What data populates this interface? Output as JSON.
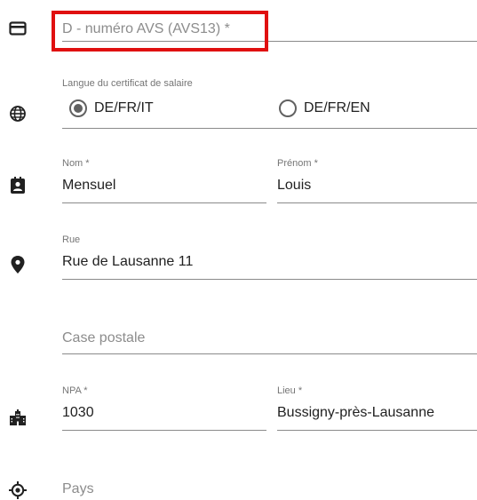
{
  "avs": {
    "placeholder": "D - numéro AVS (AVS13) *",
    "icon": "card-icon"
  },
  "language": {
    "label": "Langue du certificat de salaire",
    "icon": "globe-icon",
    "options": [
      {
        "label": "DE/FR/IT",
        "selected": true
      },
      {
        "label": "DE/FR/EN",
        "selected": false
      }
    ]
  },
  "person": {
    "icon": "contact-card-icon",
    "last_name_label": "Nom *",
    "last_name_value": "Mensuel",
    "first_name_label": "Prénom *",
    "first_name_value": "Louis"
  },
  "street": {
    "icon": "location-pin-icon",
    "label": "Rue",
    "value": "Rue de Lausanne 11"
  },
  "po_box": {
    "placeholder": "Case postale"
  },
  "city": {
    "icon": "city-icon",
    "npa_label": "NPA *",
    "npa_value": "1030",
    "lieu_label": "Lieu *",
    "lieu_value": "Bussigny-près-Lausanne"
  },
  "country": {
    "icon": "target-icon",
    "placeholder": "Pays"
  },
  "colors": {
    "highlight": "#e01010",
    "icon": "#212121",
    "underline": "#8a8a8a"
  }
}
